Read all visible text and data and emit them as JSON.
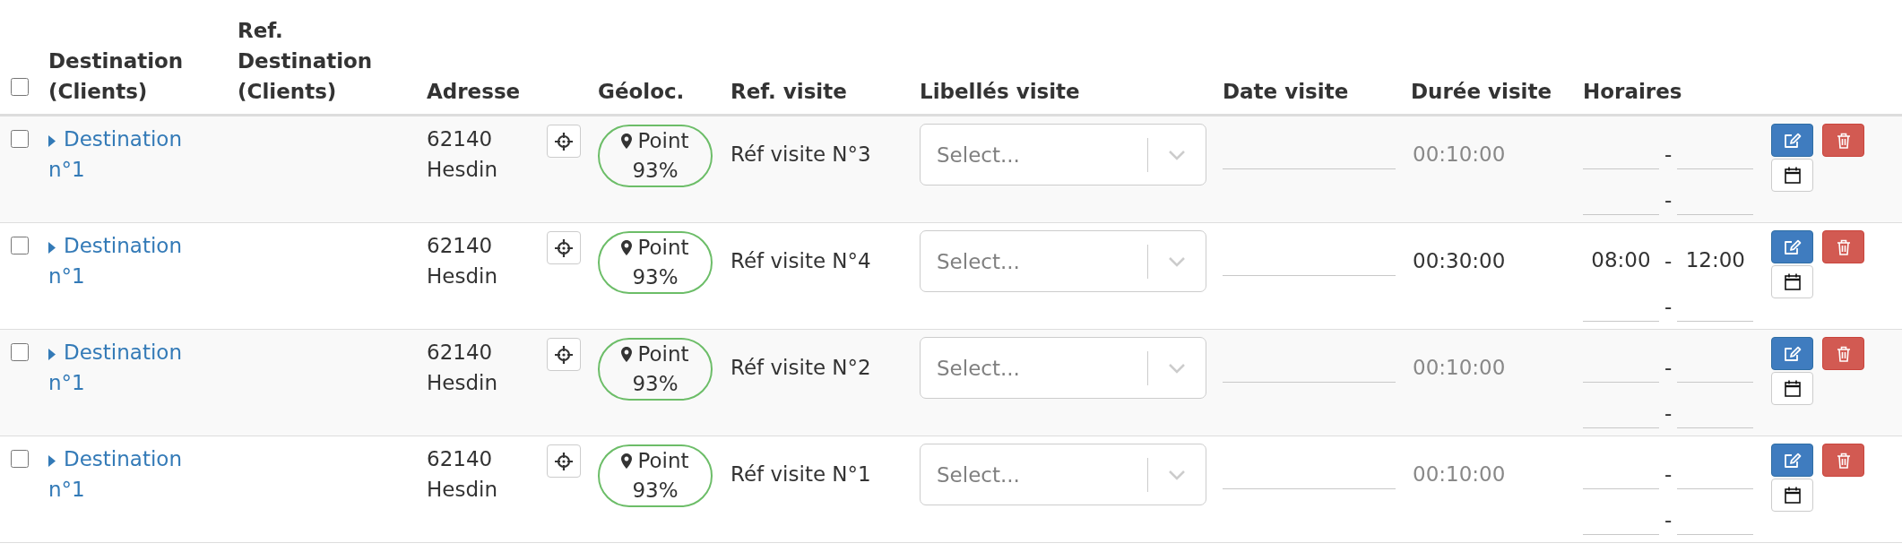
{
  "table": {
    "select_all": {
      "checked": false
    },
    "columns": [
      "Destination (Clients)",
      "Ref. Destination (Clients)",
      "Adresse",
      "Géoloc.",
      "Ref. visite",
      "Libellés visite",
      "Date visite",
      "Durée visite",
      "Horaires"
    ],
    "rows": [
      {
        "checked": false,
        "destination": "Destination n°1",
        "address": "62140 Hesdin",
        "geoloc": "Point 93%",
        "visit_ref": "Réf visite N°3",
        "visit_labels": {
          "placeholder": "Select..."
        },
        "duration": {
          "placeholder": "00:10:00"
        },
        "schedule": [
          {
            "separator": "-"
          },
          {
            "separator": "-"
          }
        ]
      },
      {
        "checked": false,
        "destination": "Destination n°1",
        "address": "62140 Hesdin",
        "geoloc": "Point 93%",
        "visit_ref": "Réf visite N°4",
        "visit_labels": {
          "placeholder": "Select..."
        },
        "duration": {
          "value": "00:30:00"
        },
        "schedule": [
          {
            "start": "08:00",
            "separator": "-",
            "end": "12:00"
          },
          {
            "separator": "-"
          }
        ]
      },
      {
        "checked": false,
        "destination": "Destination n°1",
        "address": "62140 Hesdin",
        "geoloc": "Point 93%",
        "visit_ref": "Réf visite N°2",
        "visit_labels": {
          "placeholder": "Select..."
        },
        "duration": {
          "placeholder": "00:10:00"
        },
        "schedule": [
          {
            "separator": "-"
          },
          {
            "separator": "-"
          }
        ]
      },
      {
        "checked": false,
        "destination": "Destination n°1",
        "address": "62140 Hesdin",
        "geoloc": "Point 93%",
        "visit_ref": "Réf visite N°1",
        "visit_labels": {
          "placeholder": "Select..."
        },
        "duration": {
          "placeholder": "00:10:00"
        },
        "schedule": [
          {
            "separator": "-"
          },
          {
            "separator": "-"
          }
        ]
      }
    ]
  }
}
